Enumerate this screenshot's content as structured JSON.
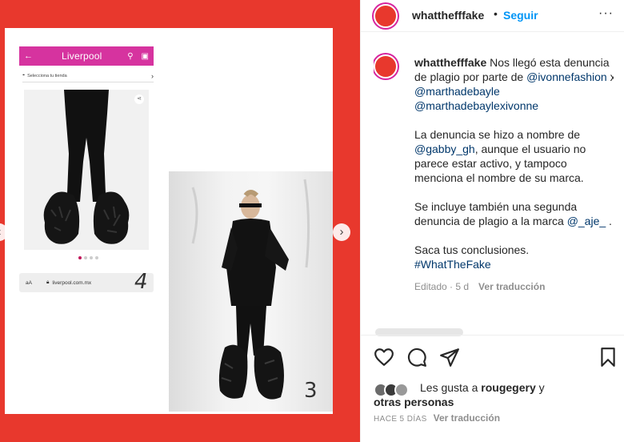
{
  "media": {
    "store_logo": "Liverpool",
    "store_select": "Selecciona tu tienda",
    "url": "liverpool.com.mx",
    "url_aa": "aA",
    "number_left": "4",
    "number_right": "3",
    "prev_glyph": "‹",
    "next_glyph": "›"
  },
  "header": {
    "username": "whatthefffake",
    "separator": "•",
    "follow_label": "Seguir",
    "more_glyph": "···"
  },
  "caption": {
    "username": "whatthefffake",
    "p1_text": "Nos llegó esta denuncia de plagio por parte de",
    "mention_ivonne": "@ivonnefashion",
    "p1_x": "x",
    "mention_martha": "@marthadebayle",
    "mention_both": "@marthadebaylexivonne",
    "p2_text": "La denuncia se hizo a nombre de",
    "mention_gabby": "@gabby_gh",
    "p2_rest": ", aunque el usuario no parece estar activo, y tampoco menciona el nombre de su marca.",
    "p3_text": "Se incluye también una segunda denuncia de plagio a la marca",
    "mention_aje": "@_aje_",
    "p3_end": ".",
    "p4_text": "Saca tus conclusiones.",
    "hashtag": "#WhatTheFake",
    "edited": "Editado · 5 d",
    "translate": "Ver traducción"
  },
  "likes": {
    "prefix": "Les gusta a",
    "user": "rougegery",
    "conj": "y",
    "others": "otras personas"
  },
  "footer": {
    "time": "HACE 5 DÍAS",
    "translate": "Ver traducción"
  },
  "colors": {
    "accent_blue": "#0095f6",
    "media_red": "#e8382d",
    "liverpool_pink": "#d6339f"
  }
}
